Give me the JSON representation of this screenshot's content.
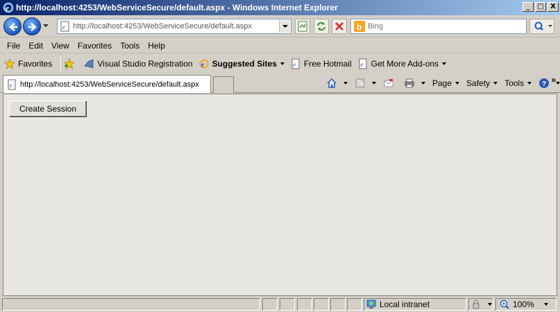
{
  "window": {
    "title": "http://localhost:4253/WebServiceSecure/default.aspx - Windows Internet Explorer",
    "buttons": [
      "_",
      "□",
      "X"
    ]
  },
  "address": {
    "url": "http://localhost:4253/WebServiceSecure/default.aspx"
  },
  "search": {
    "placeholder": "Bing"
  },
  "menu": {
    "items": [
      "File",
      "Edit",
      "View",
      "Favorites",
      "Tools",
      "Help"
    ]
  },
  "favorites": {
    "favorites_label": "Favorites",
    "items": [
      {
        "label": "Visual Studio Registration",
        "icon": "vs-icon"
      },
      {
        "label": "Suggested Sites",
        "icon": "ie-icon"
      },
      {
        "label": "Free Hotmail",
        "icon": "ie-page-icon"
      },
      {
        "label": "Get More Add-ons",
        "icon": "ie-page-icon"
      }
    ]
  },
  "tab": {
    "title": "http://localhost:4253/WebServiceSecure/default.aspx"
  },
  "commandbar": {
    "page": "Page",
    "safety": "Safety",
    "tools": "Tools"
  },
  "content": {
    "button_label": "Create Session"
  },
  "status": {
    "zone": "Local intranet",
    "zoom": "100%"
  }
}
